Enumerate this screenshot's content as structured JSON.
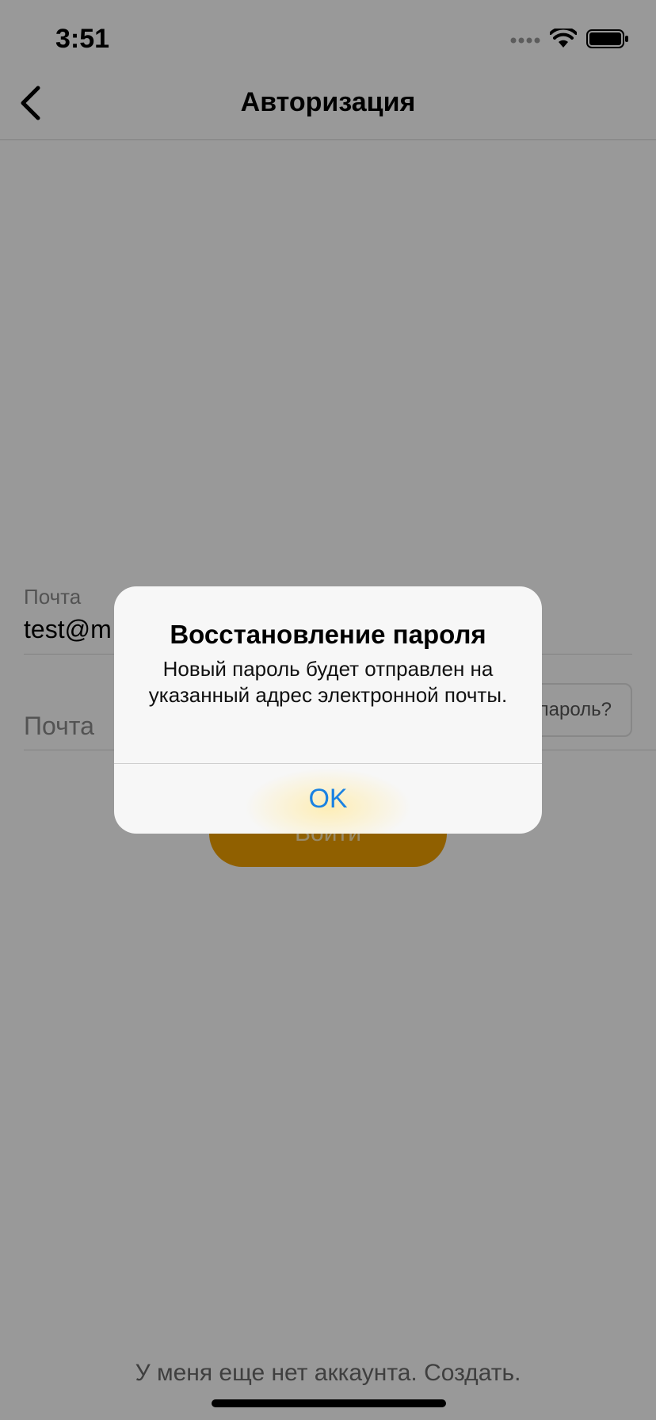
{
  "status_bar": {
    "time": "3:51"
  },
  "nav": {
    "title": "Авторизация"
  },
  "form": {
    "email_label": "Почта",
    "email_value": "test@m",
    "password_placeholder": "Почта",
    "forgot_label": "пароль?",
    "login_label": "Войти"
  },
  "footer": {
    "signup_text": "У меня еще нет аккаунта. Создать."
  },
  "alert": {
    "title": "Восстановление пароля",
    "message": "Новый пароль будет отправлен на указанный адрес электронной почты.",
    "ok_label": "OK"
  },
  "colors": {
    "accent": "#f0a000",
    "link": "#1a82e2",
    "dim_overlay": "rgba(0,0,0,0.40)"
  },
  "icons": [
    "cellular-signal-icon",
    "wifi-icon",
    "battery-icon",
    "back-chevron-icon"
  ]
}
